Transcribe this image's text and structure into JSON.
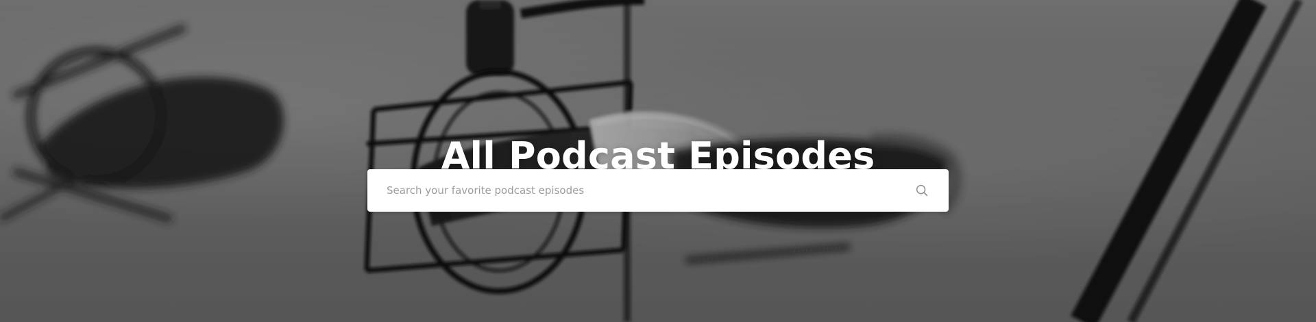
{
  "hero": {
    "title": "All Podcast Episodes",
    "background_description": "podcast-microphones",
    "colors": {
      "title": "#ffffff",
      "search_bg": "#ffffff",
      "placeholder": "#9c9c9c",
      "icon": "#8c8c8c"
    }
  },
  "search": {
    "placeholder": "Search your favorite podcast episodes",
    "value": "",
    "icon": "search-icon"
  }
}
